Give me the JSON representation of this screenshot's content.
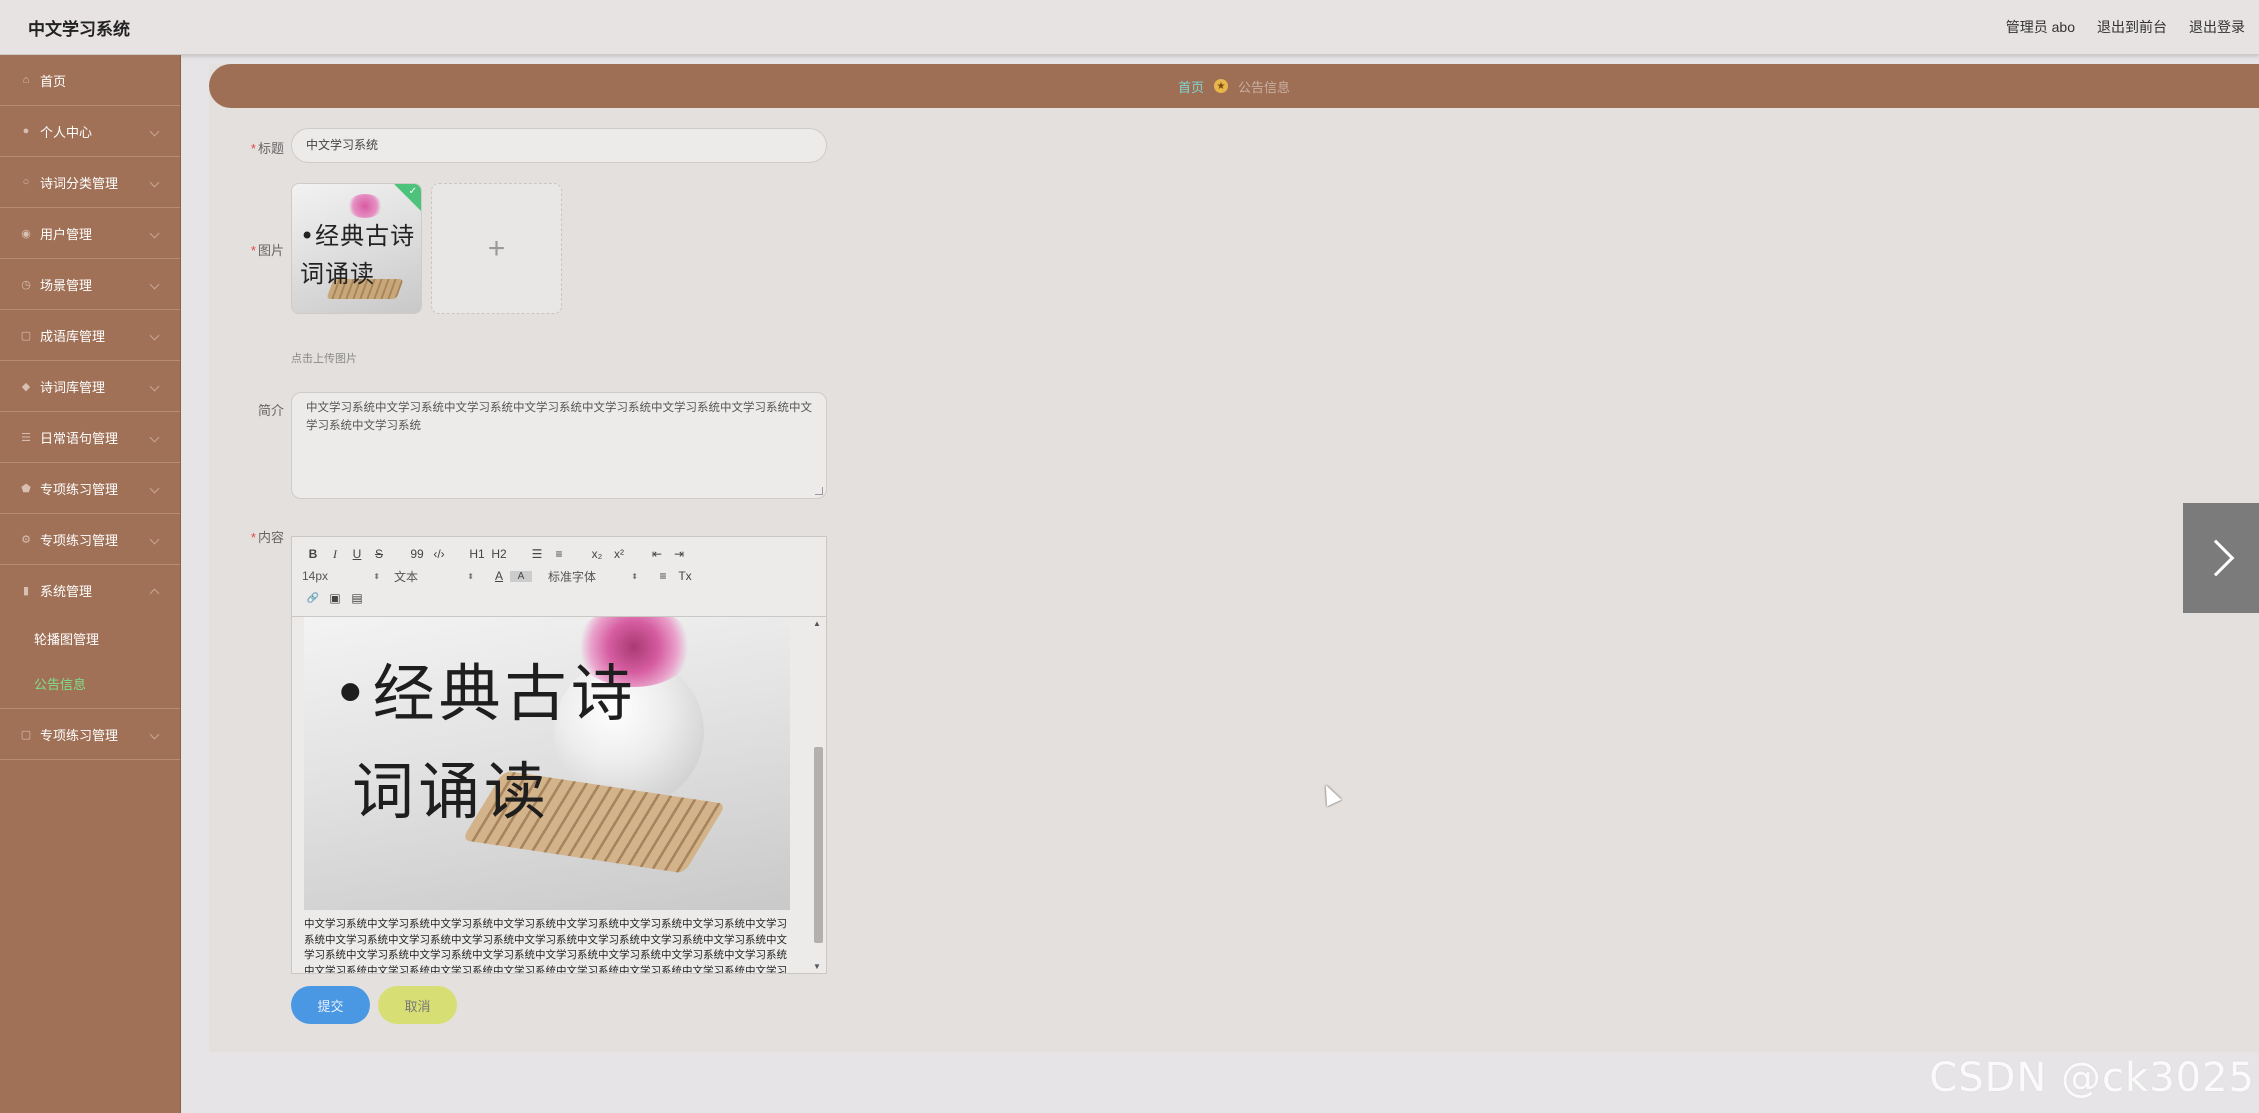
{
  "header": {
    "app_title": "中文学习系统",
    "actions": [
      "管理员 abo",
      "退出到前台",
      "退出登录"
    ]
  },
  "sidebar": {
    "items": [
      {
        "label": "首页",
        "icon": "home-icon"
      },
      {
        "label": "个人中心",
        "icon": "user-icon"
      },
      {
        "label": "诗词分类管理",
        "icon": "circle-icon"
      },
      {
        "label": "用户管理",
        "icon": "pin-icon"
      },
      {
        "label": "场景管理",
        "icon": "clock-icon"
      },
      {
        "label": "成语库管理",
        "icon": "square-icon"
      },
      {
        "label": "诗词库管理",
        "icon": "chat-icon"
      },
      {
        "label": "日常语句管理",
        "icon": "list-icon"
      },
      {
        "label": "专项练习管理",
        "icon": "shield-icon"
      },
      {
        "label": "专项练习管理",
        "icon": "gear-icon"
      },
      {
        "label": "系统管理",
        "icon": "chart-icon"
      },
      {
        "label": "专项练习管理",
        "icon": "square-icon"
      }
    ],
    "submenu": [
      {
        "label": "轮播图管理"
      },
      {
        "label": "公告信息"
      }
    ]
  },
  "breadcrumb": {
    "home": "首页",
    "current": "公告信息"
  },
  "form": {
    "title_label": "标题",
    "title_value": "中文学习系统",
    "image_label": "图片",
    "image_text_line1": "•经典古诗",
    "image_text_line2": "词诵读",
    "add_icon": "+",
    "upload_hint": "点击上传图片",
    "intro_label": "简介",
    "intro_value": "中文学习系统中文学习系统中文学习系统中文学习系统中文学习系统中文学习系统中文学习系统中文学习系统中文学习系统",
    "content_label": "内容",
    "editor": {
      "font_size": "14px",
      "block_format": "文本",
      "font_family": "标准字体",
      "buttons": {
        "bold": "B",
        "italic": "I",
        "underline": "U",
        "strike": "S",
        "quote": "99",
        "code": "‹/›",
        "h1": "H1",
        "h2": "H2",
        "ordered": "☰",
        "bullet": "≡",
        "sub": "x₂",
        "sup": "x²",
        "outdent": "⇤",
        "indent": "⇥",
        "color": "A",
        "bg": "A",
        "align": "≡",
        "clear": "Tx",
        "link": "🔗",
        "image": "▣",
        "video": "▤"
      },
      "body_text": "中文学习系统中文学习系统中文学习系统中文学习系统中文学习系统中文学习系统中文学习系统中文学习系统中文学习系统中文学习系统中文学习系统中文学习系统中文学习系统中文学习系统中文学习系统中文学习系统中文学习系统中文学习系统中文学习系统中文学习系统中文学习系统中文学习系统中文学习系统中文学习系统中文学习系统中文学习系统中文学习系统中文学习系统中文学习系统中文学习系统中文学习系统中文学习系统中文学习系统中文学习系统中文学习系统中文学习系统中文学习系统中文学习系统中文学习系统中文学习系统中文学习系统"
    },
    "submit_label": "提交",
    "cancel_label": "取消"
  },
  "watermark": "CSDN @ck3025"
}
